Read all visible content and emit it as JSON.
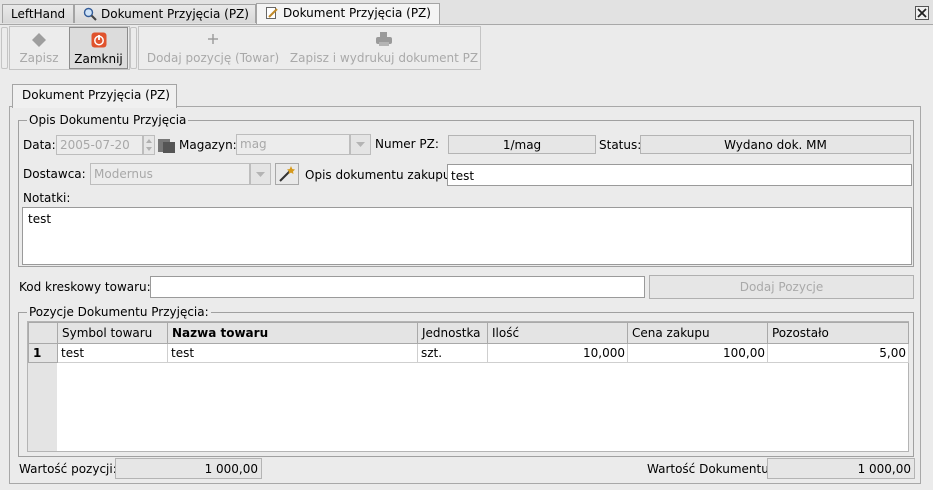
{
  "tabs": [
    {
      "label": "LeftHand"
    },
    {
      "label": "Dokument Przyjęcia (PZ)",
      "icon": "magnifier-icon"
    },
    {
      "label": "Dokument Przyjęcia (PZ)",
      "icon": "edit-document-icon"
    }
  ],
  "toolbar": {
    "save_label": "Zapisz",
    "close_label": "Zamknij",
    "add_item_label": "Dodaj pozycję (Towar)",
    "save_print_label": "Zapisz i wydrukuj dokument PZ"
  },
  "main_tab_label": "Dokument Przyjęcia (PZ)",
  "description_group": {
    "legend": "Opis Dokumentu Przyjęcia",
    "date_label": "Data:",
    "date_value": "2005-07-20",
    "warehouse_label": "Magazyn:",
    "warehouse_value": "mag",
    "pz_number_label": "Numer PZ:",
    "pz_number_value": "1/mag",
    "status_label": "Status:",
    "status_value": "Wydano dok. MM",
    "supplier_label": "Dostawca:",
    "supplier_value": "Modernus",
    "purchase_desc_label": "Opis dokumentu zakupu:",
    "purchase_desc_value": "test",
    "notes_label": "Notatki:",
    "notes_value": "test"
  },
  "barcode": {
    "label": "Kod kreskowy towaru:",
    "value": "",
    "add_button_label": "Dodaj Pozycje"
  },
  "items_group": {
    "legend": "Pozycje Dokumentu Przyjęcia:",
    "columns": [
      "Symbol towaru",
      "Nazwa towaru",
      "Jednostka",
      "Ilość",
      "Cena zakupu",
      "Pozostało"
    ],
    "rows": [
      {
        "num": "1",
        "symbol": "test",
        "name": "test",
        "unit": "szt.",
        "qty": "10,000",
        "price": "100,00",
        "remaining": "5,00"
      }
    ]
  },
  "footer": {
    "items_value_label": "Wartość pozycji:",
    "items_value": "1 000,00",
    "doc_value_label": "Wartość Dokumentu:",
    "doc_value": "1 000,00"
  }
}
